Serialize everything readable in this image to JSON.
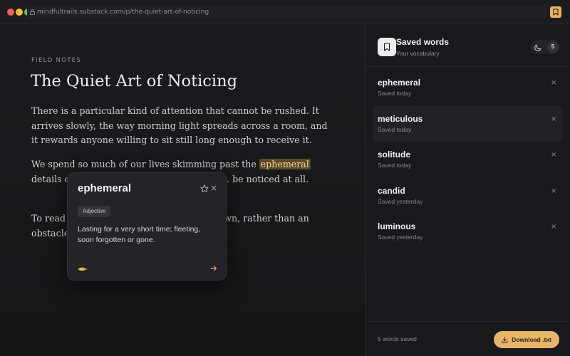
{
  "browser": {
    "url": "mindfultrails.substack.com/p/the-quiet-art-of-noticing",
    "traffic_colors": [
      "#ed5f57",
      "#f2bd3b",
      "#5fc54f"
    ]
  },
  "article": {
    "kicker": "FIELD NOTES",
    "title": "The Quiet Art of Noticing",
    "p1": "There is a particular kind of attention that cannot be rushed. It arrives slowly, the way morning light spreads across a room, and it rewards anyone willing to sit still long enough to receive it.",
    "p2_before": "We spend so much of our lives skimming past the ",
    "p2_highlight": "ephemeral",
    "p2_after": " details o… repeatable afternoon, that we … be noticed at all.",
    "p3": "To read … ntion on the page. Every u… down, rather than an obstacle"
  },
  "popover": {
    "word": "ephemeral",
    "part_of_speech": "Adjective",
    "definition": "Lasting for a very short time; fleeting, soon forgotten or gone.",
    "icons": [
      "star-icon",
      "close-icon",
      "audio-icon",
      "arrow-right-icon"
    ]
  },
  "sidebar": {
    "title": "Saved words",
    "subtitle": "Your vocabulary",
    "count": "5",
    "items": [
      {
        "word": "ephemeral",
        "meta": "Saved today",
        "remove": "×"
      },
      {
        "word": "meticulous",
        "meta": "Saved today",
        "remove": "×"
      },
      {
        "word": "solitude",
        "meta": "Saved today",
        "remove": "×"
      },
      {
        "word": "candid",
        "meta": "Saved yesterday",
        "remove": "×"
      },
      {
        "word": "luminous",
        "meta": "Saved yesterday",
        "remove": "×"
      }
    ],
    "footer_text": "5 words saved",
    "download_label": "Download .txt",
    "accent": "#e6b567"
  }
}
